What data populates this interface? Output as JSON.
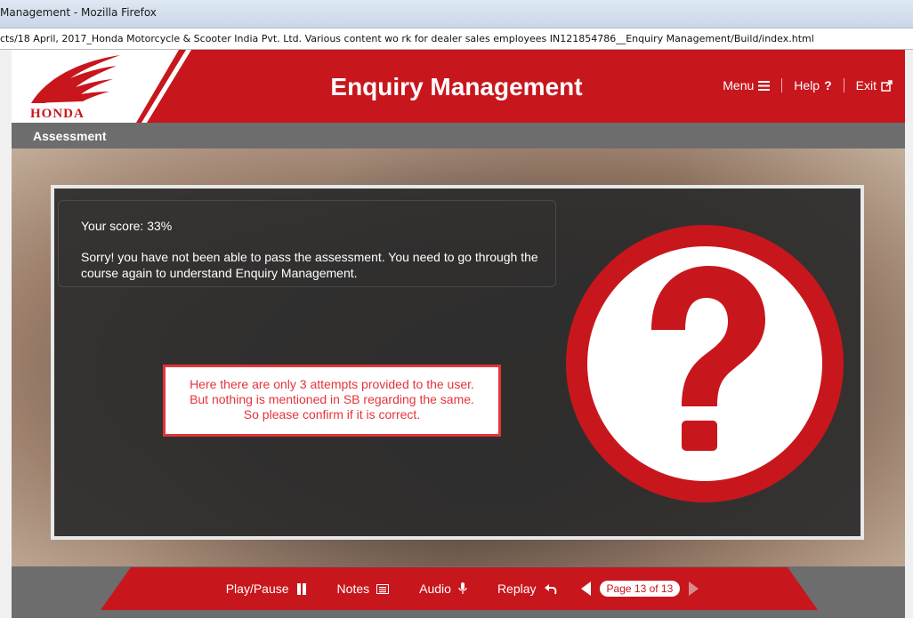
{
  "browser": {
    "window_title": "Management - Mozilla Firefox",
    "url": "cts/18 April, 2017_Honda Motorcycle & Scooter India Pvt. Ltd. Various content wo rk for dealer sales employees IN121854786__Enquiry Management/Build/index.html"
  },
  "header": {
    "logo_text": "HONDA",
    "course_title": "Enquiry Management",
    "nav": {
      "menu_label": "Menu",
      "help_label": "Help",
      "exit_label": "Exit"
    }
  },
  "section": {
    "label": "Assessment"
  },
  "content": {
    "score_text": "Your score: 33%",
    "message": "Sorry! you have not been able to pass the assessment. You need to go through the course again to understand Enquiry Management.",
    "review_note_lines": [
      "Here there are only 3 attempts provided to the user.",
      "But nothing is mentioned in SB regarding the same.",
      "So please confirm if it is correct."
    ]
  },
  "footer": {
    "play_pause_label": "Play/Pause",
    "notes_label": "Notes",
    "audio_label": "Audio",
    "replay_label": "Replay",
    "page_indicator": "Page 13 of 13"
  },
  "colors": {
    "brand_red": "#c8161d",
    "note_red": "#e3343a",
    "panel_dark": "#2c2c2c",
    "bar_gray": "#6d6d6d"
  },
  "icons": [
    "hamburger-icon",
    "help-icon",
    "external-link-icon",
    "pause-icon",
    "notes-icon",
    "microphone-icon",
    "replay-icon",
    "prev-arrow-icon",
    "next-arrow-icon",
    "question-mark-icon",
    "honda-wing-logo"
  ]
}
